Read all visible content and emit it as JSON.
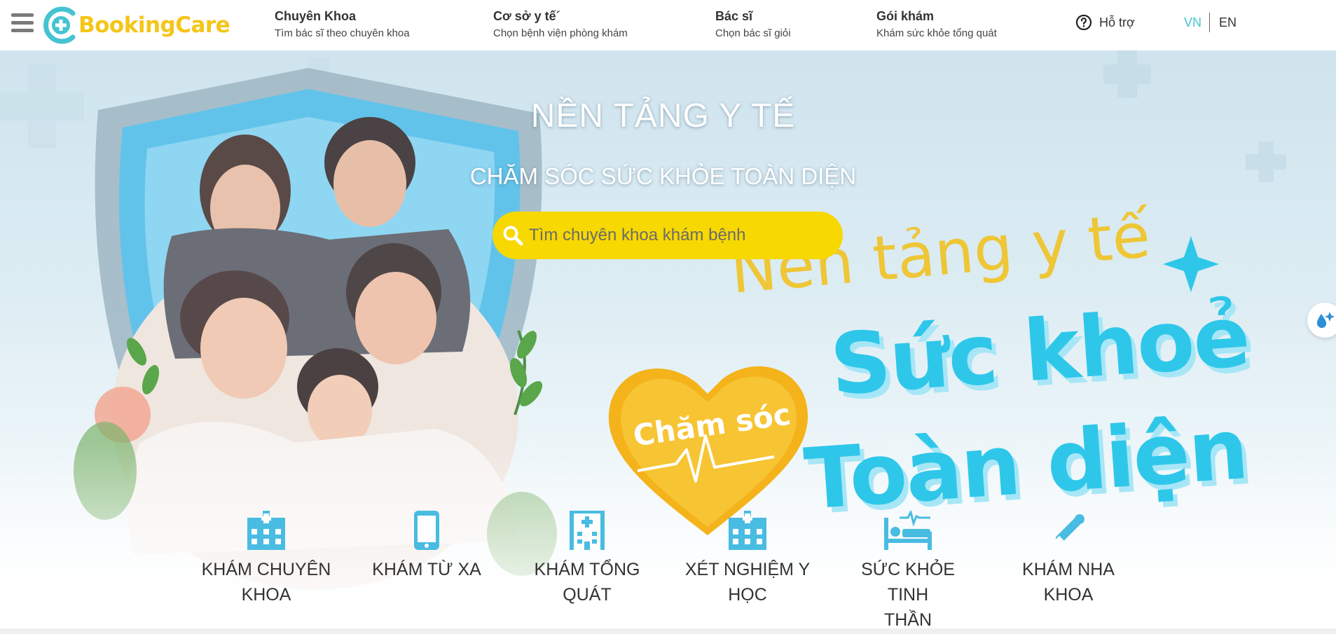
{
  "header": {
    "menu_icon": "hamburger-menu-icon",
    "logo_text": "BookingCare",
    "nav": [
      {
        "title": "Chuyên Khoa",
        "subtitle": "Tìm bác sĩ theo chuyên khoa"
      },
      {
        "title": "Cơ sở y tế´",
        "subtitle": "Chọn bệnh viện phòng khám"
      },
      {
        "title": "Bác sĩ",
        "subtitle": "Chọn bác sĩ giỏi"
      },
      {
        "title": "Gói khám",
        "subtitle": "Khám sức khỏe tổng quát"
      }
    ],
    "support_label": "Hỗ trợ",
    "lang_vn": "VN",
    "lang_en": "EN"
  },
  "banner": {
    "headline": "NỀN TẢNG Y TẾ",
    "subheadline": "CHĂM SÓC SỨC KHỎE TOÀN DIỆN",
    "search_placeholder": "Tìm chuyên khoa khám bệnh",
    "art_top": "Nền tảng y tế",
    "art_line1": "Sức khoẻ",
    "art_line2": "Toàn diện",
    "heart_text": "Chăm sóc"
  },
  "services": [
    {
      "icon": "hospital-icon",
      "label_line1": "KHÁM CHUYÊN",
      "label_line2": "KHOA"
    },
    {
      "icon": "smartphone-icon",
      "label_line1": "KHÁM TỪ XA",
      "label_line2": ""
    },
    {
      "icon": "clinic-building-icon",
      "label_line1": "KHÁM TỔNG",
      "label_line2": "QUÁT"
    },
    {
      "icon": "hospital-icon",
      "label_line1": "XÉT NGHIỆM Y",
      "label_line2": "HỌC"
    },
    {
      "icon": "hospital-bed-icon",
      "label_line1": "SỨC KHỎE TINH",
      "label_line2": "THẦN"
    },
    {
      "icon": "dental-tool-icon",
      "label_line1": "KHÁM NHA",
      "label_line2": "KHOA"
    }
  ],
  "colors": {
    "brand_yellow": "#f5c518",
    "brand_cyan": "#45c3d2",
    "search_yellow": "#f7d800",
    "icon_cyan": "#49bce2"
  }
}
